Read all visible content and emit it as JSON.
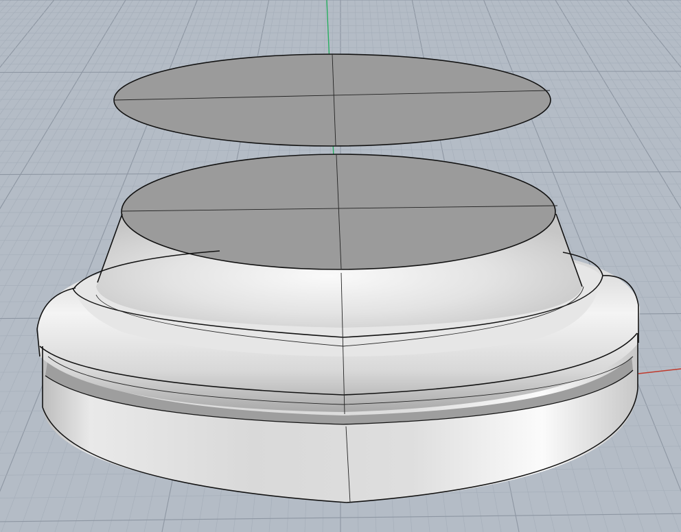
{
  "viewport": {
    "label": "",
    "view": "perspective",
    "display_mode": "shaded",
    "background_color": "#b4bcc6",
    "grid_minor_color": "#a6afba",
    "grid_major_color": "#8d96a2",
    "x_axis_color": "#c0392b",
    "y_axis_color": "#27ae60",
    "surface_color": "#e4e4e4",
    "cap_color": "#9b9b9b",
    "edge_color": "#111111"
  },
  "scene": {
    "objects": [
      "floating-disc-surface",
      "pedestal-base-solid"
    ]
  }
}
